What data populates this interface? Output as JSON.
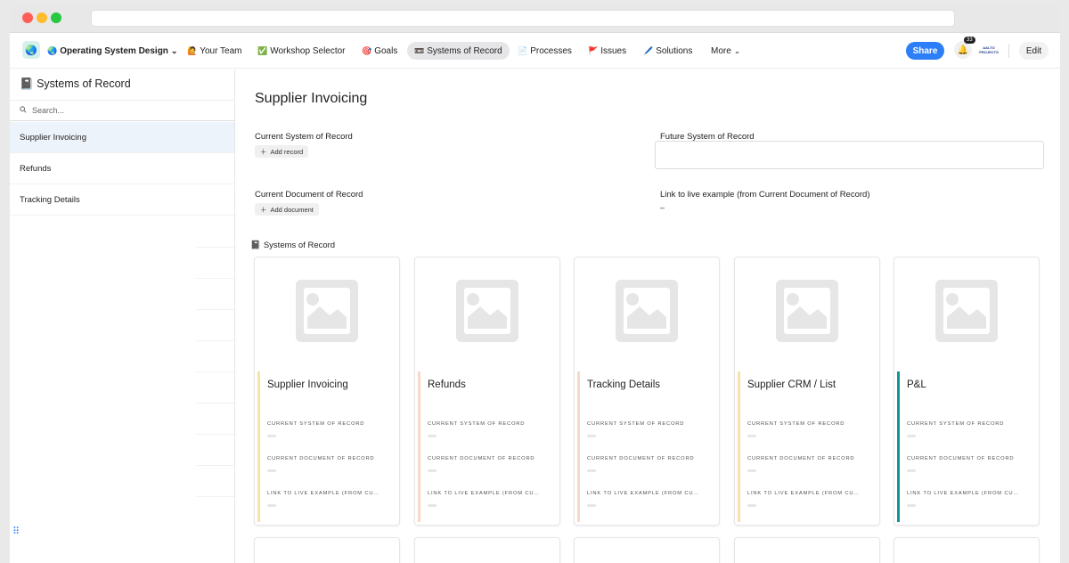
{
  "nav": {
    "app_icon": "globe-icon",
    "title": "Operating System Design",
    "items": [
      {
        "label": "Your Team",
        "icon": "🙋"
      },
      {
        "label": "Workshop Selector",
        "icon": "✅"
      },
      {
        "label": "Goals",
        "icon": "🎯"
      },
      {
        "label": "Systems of Record",
        "icon": "📼"
      },
      {
        "label": "Processes",
        "icon": "📄"
      },
      {
        "label": "Issues",
        "icon": "🚩"
      },
      {
        "label": "Solutions",
        "icon": "🖊️"
      },
      {
        "label": "More",
        "icon": ""
      }
    ],
    "active_index": 3,
    "share_label": "Share",
    "notification_count": "33",
    "avatar_text": "AALTO PROJECTS",
    "edit_label": "Edit"
  },
  "sidebar": {
    "title": "Systems of Record",
    "title_icon": "📓",
    "search_placeholder": "Search...",
    "items": [
      {
        "label": "Supplier Invoicing",
        "selected": true
      },
      {
        "label": "Refunds",
        "selected": false
      },
      {
        "label": "Tracking Details",
        "selected": false
      }
    ]
  },
  "record": {
    "title": "Supplier Invoicing",
    "current_system_label": "Current System of Record",
    "add_record_label": "Add record",
    "future_system_label": "Future System of Record",
    "current_document_label": "Current Document of Record",
    "add_document_label": "Add document",
    "link_label": "Link to live example (from Current Document of Record)",
    "link_value": "–"
  },
  "gallery": {
    "title": "Systems of Record",
    "title_icon": "📓",
    "field_labels": [
      "CURRENT SYSTEM OF RECORD",
      "CURRENT DOCUMENT OF RECORD",
      "LINK TO LIVE EXAMPLE (FROM CU…"
    ],
    "cards": [
      {
        "title": "Supplier Invoicing",
        "color": "#f9e1a8"
      },
      {
        "title": "Refunds",
        "color": "#f9d8c8"
      },
      {
        "title": "Tracking Details",
        "color": "#f9d8c8"
      },
      {
        "title": "Supplier CRM / List",
        "color": "#f9e1a8"
      },
      {
        "title": "P&L",
        "color": "#0a9a96"
      }
    ]
  }
}
